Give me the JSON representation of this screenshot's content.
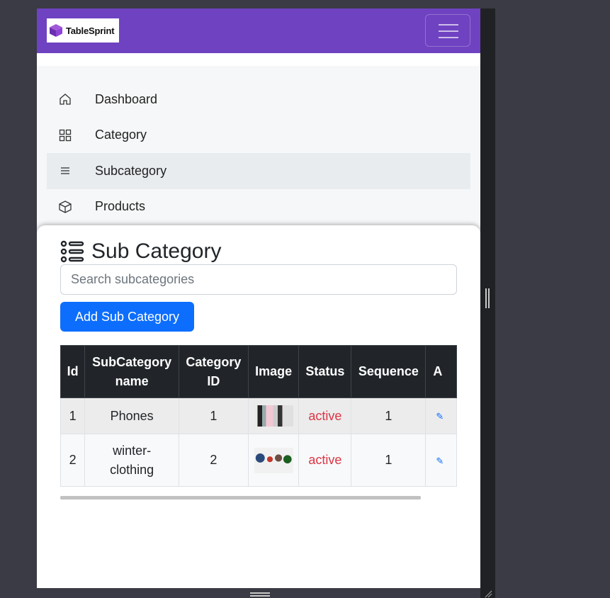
{
  "brand": {
    "name": "TableSprint"
  },
  "sidebar": {
    "items": [
      {
        "label": "Dashboard",
        "icon": "home-icon",
        "active": false
      },
      {
        "label": "Category",
        "icon": "grid-icon",
        "active": false
      },
      {
        "label": "Subcategory",
        "icon": "list-icon",
        "active": true
      },
      {
        "label": "Products",
        "icon": "box-icon",
        "active": false
      }
    ]
  },
  "page": {
    "title": "Sub Category",
    "search": {
      "placeholder": "Search subcategories",
      "value": ""
    },
    "add_button_label": "Add Sub Category"
  },
  "table": {
    "headers": [
      "Id",
      "SubCategory name",
      "Category ID",
      "Image",
      "Status",
      "Sequence",
      "A"
    ],
    "rows": [
      {
        "id": "1",
        "name": "Phones",
        "category_id": "1",
        "status": "active",
        "sequence": "1"
      },
      {
        "id": "2",
        "name": "winter-clothing",
        "category_id": "2",
        "status": "active",
        "sequence": "1"
      }
    ]
  },
  "colors": {
    "navbar": "#6f42c1",
    "primary": "#0d6efd",
    "status_active": "#dc3545",
    "table_header": "#212529"
  }
}
